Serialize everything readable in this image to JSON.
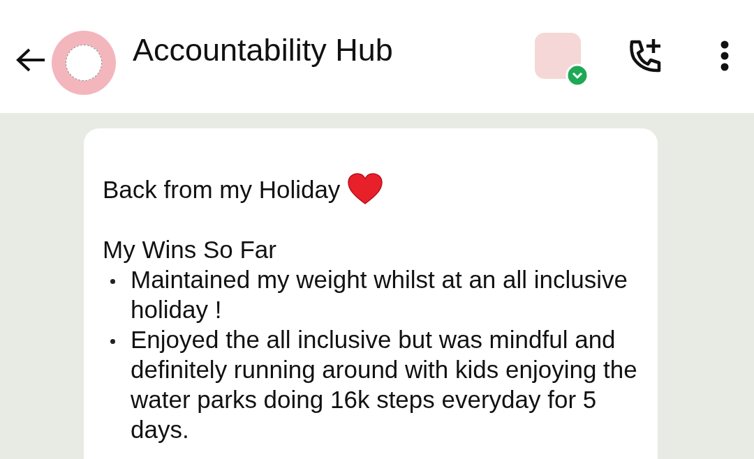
{
  "header": {
    "title": "Accountability Hub"
  },
  "message": {
    "heading": "Back from my Holiday",
    "subheading": "My Wins So Far",
    "bullets": [
      {
        "text": "Maintained my weight whilst at an all inclusive holiday !"
      },
      {
        "text": "Enjoyed the all inclusive but was mindful and definitely running around with kids enjoying the water parks doing 16k steps everyday for 5 days."
      }
    ]
  }
}
